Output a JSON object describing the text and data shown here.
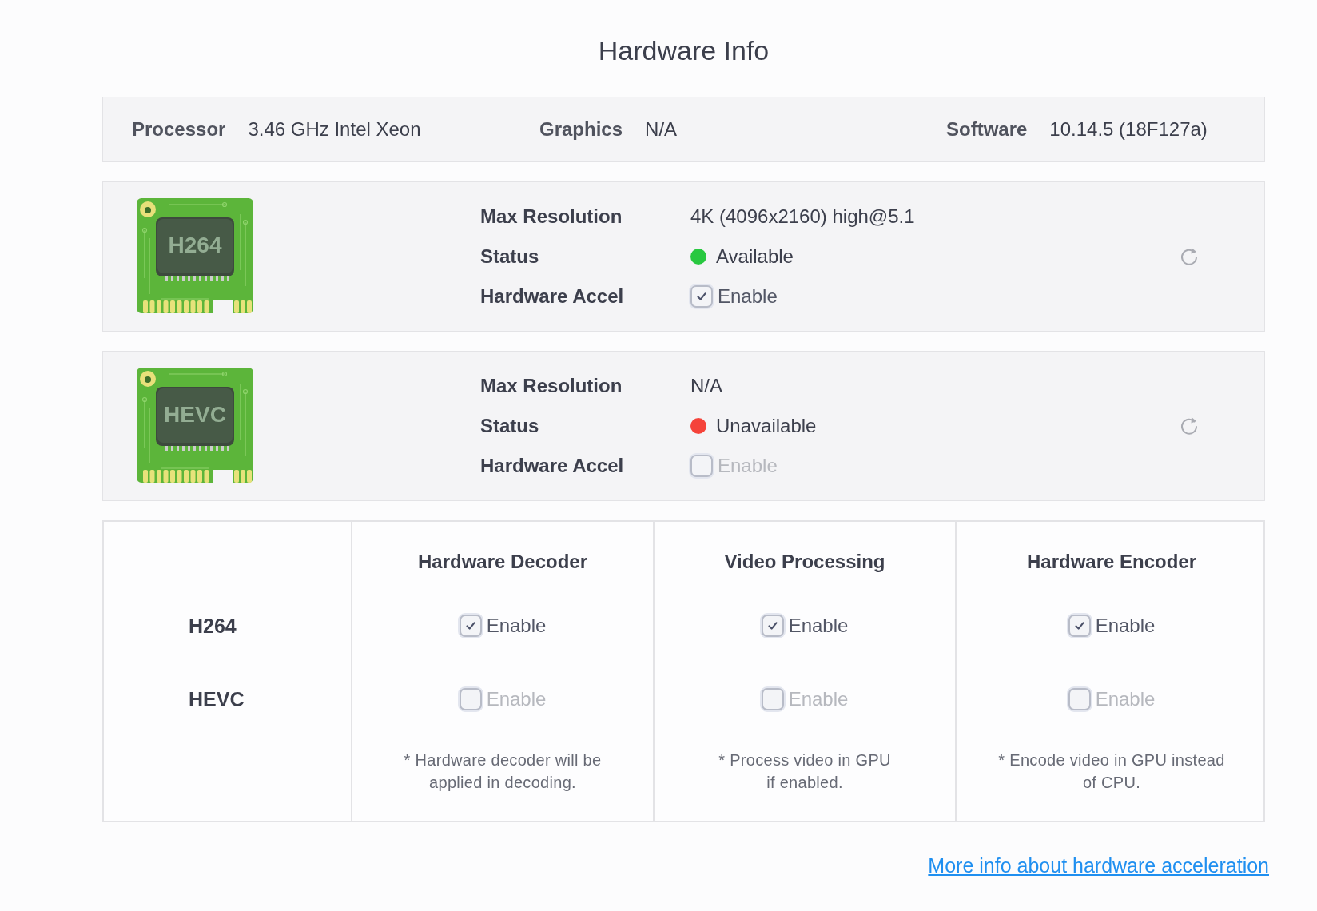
{
  "title": "Hardware Info",
  "system": [
    {
      "label": "Processor",
      "value": "3.46 GHz Intel Xeon"
    },
    {
      "label": "Graphics",
      "value": "N/A"
    },
    {
      "label": "Software",
      "value": "10.14.5 (18F127a)"
    }
  ],
  "codecs": [
    {
      "chip_label": "H264",
      "fields": [
        {
          "kind": "text",
          "label": "Max Resolution",
          "value": "4K (4096x2160) high@5.1"
        },
        {
          "kind": "status",
          "label": "Status",
          "value": "Available",
          "color": "#28c840"
        },
        {
          "kind": "checkbox",
          "label": "Hardware Accel",
          "value": "Enable",
          "checked": true,
          "disabled": false
        }
      ]
    },
    {
      "chip_label": "HEVC",
      "fields": [
        {
          "kind": "text",
          "label": "Max Resolution",
          "value": "N/A"
        },
        {
          "kind": "status",
          "label": "Status",
          "value": "Unavailable",
          "color": "#f5433a"
        },
        {
          "kind": "checkbox",
          "label": "Hardware Accel",
          "value": "Enable",
          "checked": false,
          "disabled": true
        }
      ]
    }
  ],
  "matrix": {
    "rows": [
      "H264",
      "HEVC"
    ],
    "columns": [
      {
        "title": "Hardware Decoder",
        "options": [
          {
            "label": "Enable",
            "checked": true,
            "disabled": false
          },
          {
            "label": "Enable",
            "checked": false,
            "disabled": true
          }
        ],
        "note": "* Hardware decoder will be\napplied in decoding."
      },
      {
        "title": "Video Processing",
        "options": [
          {
            "label": "Enable",
            "checked": true,
            "disabled": false
          },
          {
            "label": "Enable",
            "checked": false,
            "disabled": true
          }
        ],
        "note": "* Process video in GPU\nif enabled."
      },
      {
        "title": "Hardware Encoder",
        "options": [
          {
            "label": "Enable",
            "checked": true,
            "disabled": false
          },
          {
            "label": "Enable",
            "checked": false,
            "disabled": true
          }
        ],
        "note": "* Encode video in GPU instead\nof CPU."
      }
    ]
  },
  "link": "More info about hardware acceleration"
}
